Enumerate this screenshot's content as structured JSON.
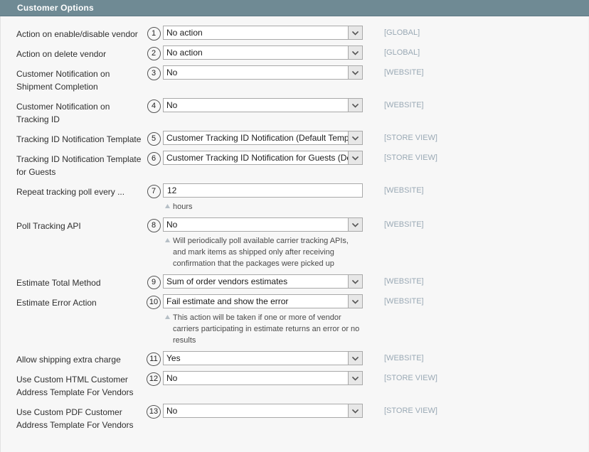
{
  "panel": {
    "title": "Customer Options"
  },
  "icons": {
    "dropdown_arrow": "chevron-down-icon",
    "hint_marker": "triangle-up-icon"
  },
  "colors": {
    "header_bg": "#6f8a94",
    "header_text": "#ffffff",
    "page_bg": "#f7f7f7",
    "scope_text": "#9aa9b5",
    "input_border": "#a9a9a9",
    "input_bg": "#ffffff",
    "arrow_bg": "#e7e7e7"
  },
  "fields": [
    {
      "num": "1",
      "label": "Action on enable/disable vendor",
      "type": "select",
      "value": "No action",
      "scope": "[GLOBAL]",
      "hint": ""
    },
    {
      "num": "2",
      "label": "Action on delete vendor",
      "type": "select",
      "value": "No action",
      "scope": "[GLOBAL]",
      "hint": ""
    },
    {
      "num": "3",
      "label": "Customer Notification on Shipment Completion",
      "type": "select",
      "value": "No",
      "scope": "[WEBSITE]",
      "hint": ""
    },
    {
      "num": "4",
      "label": "Customer Notification on Tracking ID",
      "type": "select",
      "value": "No",
      "scope": "[WEBSITE]",
      "hint": ""
    },
    {
      "num": "5",
      "label": "Tracking ID Notification Template",
      "type": "select",
      "value": "Customer Tracking ID Notification (Default Template)",
      "scope": "[STORE VIEW]",
      "hint": ""
    },
    {
      "num": "6",
      "label": "Tracking ID Notification Template for Guests",
      "type": "select",
      "value": "Customer Tracking ID Notification for Guests (Default Template)",
      "scope": "[STORE VIEW]",
      "hint": ""
    },
    {
      "num": "7",
      "label": "Repeat tracking poll every ...",
      "type": "text",
      "value": "12",
      "scope": "[WEBSITE]",
      "hint": "hours"
    },
    {
      "num": "8",
      "label": "Poll Tracking API",
      "type": "select",
      "value": "No",
      "scope": "[WEBSITE]",
      "hint": "Will periodically poll available carrier tracking APIs, and mark items as shipped only after receiving confirmation that the packages were picked up"
    },
    {
      "num": "9",
      "label": "Estimate Total Method",
      "type": "select",
      "value": "Sum of order vendors estimates",
      "scope": "[WEBSITE]",
      "hint": ""
    },
    {
      "num": "10",
      "label": "Estimate Error Action",
      "type": "select",
      "value": "Fail estimate and show the error",
      "scope": "[WEBSITE]",
      "hint": "This action will be taken if one or more of vendor carriers participating in estimate returns an error or no results"
    },
    {
      "num": "11",
      "label": "Allow shipping extra charge",
      "type": "select",
      "value": "Yes",
      "scope": "[WEBSITE]",
      "hint": ""
    },
    {
      "num": "12",
      "label": "Use Custom HTML Customer Address Template For Vendors",
      "type": "select",
      "value": "No",
      "scope": "[STORE VIEW]",
      "hint": ""
    },
    {
      "num": "13",
      "label": "Use Custom PDF Customer Address Template For Vendors",
      "type": "select",
      "value": "No",
      "scope": "[STORE VIEW]",
      "hint": ""
    }
  ]
}
